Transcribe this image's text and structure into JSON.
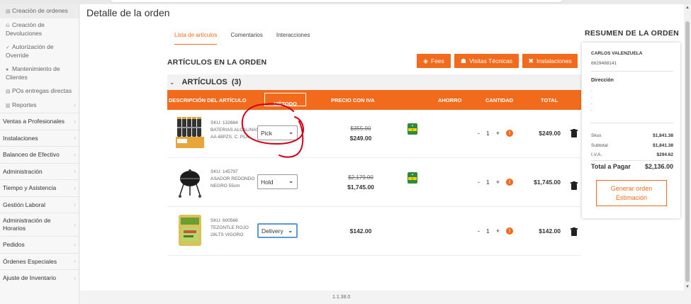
{
  "sidebar": {
    "sub_items": [
      {
        "icon": "grid-icon",
        "label": "Creación de ordenes",
        "active": true
      },
      {
        "icon": "return-icon",
        "label": "Creación de Devoluciones",
        "active": false
      },
      {
        "icon": "check-icon",
        "label": "Autorización de Override",
        "active": false
      },
      {
        "icon": "user-icon",
        "label": "Mantenimiento de Clientes",
        "active": false
      },
      {
        "icon": "grid-icon",
        "label": "POs entregas directas",
        "active": false
      },
      {
        "icon": "report-icon",
        "label": "Reportes",
        "active": false
      }
    ],
    "main_items": [
      {
        "label": "Ventas a Profesionales"
      },
      {
        "label": "Instalaciones"
      },
      {
        "label": "Balanceo de Efectivo"
      },
      {
        "label": "Administración"
      },
      {
        "label": "Tiempo y Asistencia"
      },
      {
        "label": "Gestión Laboral"
      },
      {
        "label": "Administración de Horarios"
      },
      {
        "label": "Pedidos"
      },
      {
        "label": "Órdenes Especiales"
      },
      {
        "label": "Ajuste de Inventario"
      }
    ]
  },
  "page": {
    "title": "Detalle de la orden",
    "tabs": [
      {
        "label": "Lista de artículos",
        "active": true
      },
      {
        "label": "Comentarios",
        "active": false
      },
      {
        "label": "Interacciones",
        "active": false
      }
    ],
    "section_title": "ARTÍCULOS EN LA ORDEN",
    "action_buttons": {
      "fees": "Fees",
      "visitas": "Visitas Técnicas",
      "instalaciones": "Instalaciones"
    },
    "group_label": "ARTÍCULOS",
    "group_count": "(3)",
    "columns": {
      "description": "DESCRIPCIÓN DEL ARTÍCULO",
      "method": "MÉTODO",
      "price": "PRECIO CON IVA",
      "saving": "AHORRO",
      "quantity": "CANTIDAD",
      "total": "TOTAL"
    },
    "items": [
      {
        "sku": "SKU: 132684",
        "name": "BATERIAS ALCALINAS AA 48PZS. C. PLA",
        "method": "Pick",
        "old_price": "$355.00",
        "price": "$249.00",
        "has_saving_tag": true,
        "qty": "1",
        "total": "$249.00"
      },
      {
        "sku": "SKU: 145797",
        "name": "ASADOR REDONDO NEGRO 55cm",
        "method": "Hold",
        "old_price": "$2,179.00",
        "price": "$1,745.00",
        "has_saving_tag": true,
        "qty": "1",
        "total": "$1,745.00"
      },
      {
        "sku": "SKU: 600566",
        "name": "TEZONTLE ROJO 28LTS VIGORO",
        "method": "Delivery",
        "old_price": "",
        "price": "$142.00",
        "has_saving_tag": false,
        "qty": "1",
        "total": "$142.00"
      }
    ],
    "qty_minus": "-",
    "qty_plus": "+"
  },
  "summary": {
    "title": "RESUMEN DE LA ORDEN",
    "customer_name": "CARLOS VALENZUELA",
    "customer_phone": "6629488141",
    "address_label": "Dirección",
    "address_lines": [
      ".",
      ".",
      ".",
      "."
    ],
    "rows": [
      {
        "label": "Skus",
        "value": "$1,841.38"
      },
      {
        "label": "Subtotal",
        "value": "$1,841.38"
      },
      {
        "label": "I.V.A.",
        "value": "$294.62"
      }
    ],
    "total_label": "Total a Pagar",
    "total_value": "$2,136.00",
    "generate_button": "Generar orden Estimación"
  },
  "footer": {
    "version": "1.1.38.0"
  },
  "colors": {
    "accent": "#f26b1d",
    "annotation": "#d0021b",
    "focus": "#5b9bd5"
  }
}
